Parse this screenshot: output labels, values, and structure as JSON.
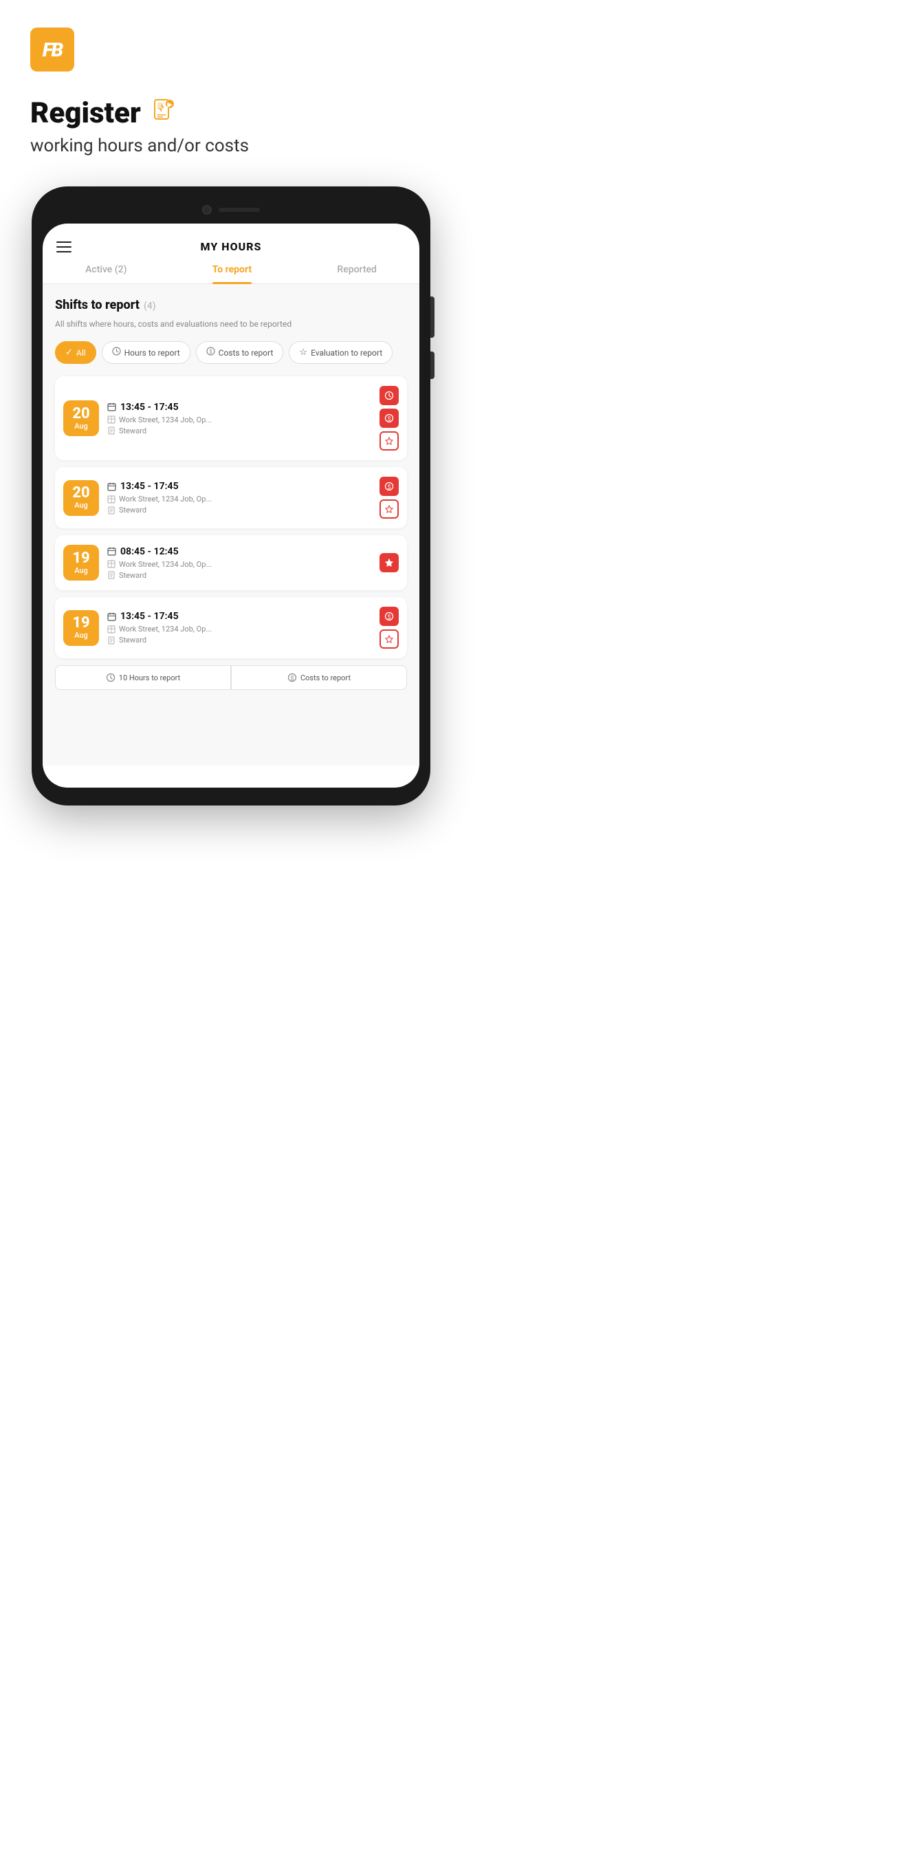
{
  "logo": {
    "text": "FB",
    "alt": "FB Logo"
  },
  "header": {
    "title": "Register",
    "subtitle": "working hours and/or costs",
    "title_icon": "⚡"
  },
  "app": {
    "screen_title": "MY HOURS",
    "tabs": [
      {
        "id": "active",
        "label": "Active (2)",
        "active": false
      },
      {
        "id": "to_report",
        "label": "To report",
        "active": true
      },
      {
        "id": "reported",
        "label": "Reported",
        "active": false
      }
    ],
    "section": {
      "title": "Shifts to report",
      "count": "(4)",
      "description": "All shifts where hours, costs and evaluations need to be reported"
    },
    "filters": [
      {
        "id": "all",
        "label": "All",
        "active": true,
        "icon": "✓"
      },
      {
        "id": "hours",
        "label": "Hours to report",
        "active": false,
        "icon": "🕐"
      },
      {
        "id": "costs",
        "label": "Costs to report",
        "active": false,
        "icon": "💰"
      },
      {
        "id": "evaluation",
        "label": "Evaluation to report",
        "active": false,
        "icon": "★"
      }
    ],
    "shifts": [
      {
        "id": 1,
        "day": "20",
        "month": "Aug",
        "time": "13:45 - 17:45",
        "location": "Work Street, 1234 Job, Op...",
        "role": "Steward",
        "actions": [
          "clock",
          "cost",
          "star"
        ],
        "has_clock": true,
        "has_cost": true,
        "has_star": true,
        "star_outline": false
      },
      {
        "id": 2,
        "day": "20",
        "month": "Aug",
        "time": "13:45 - 17:45",
        "location": "Work Street, 1234 Job, Op...",
        "role": "Steward",
        "actions": [
          "cost",
          "star"
        ],
        "has_clock": false,
        "has_cost": true,
        "has_star": true,
        "star_outline": true
      },
      {
        "id": 3,
        "day": "19",
        "month": "Aug",
        "time": "08:45 - 12:45",
        "location": "Work Street, 1234 Job, Op...",
        "role": "Steward",
        "actions": [
          "star"
        ],
        "has_clock": false,
        "has_cost": false,
        "has_star": true,
        "star_outline": false
      },
      {
        "id": 4,
        "day": "19",
        "month": "Aug",
        "time": "13:45 - 17:45",
        "location": "Work Street, 1234 Job, Op...",
        "role": "Steward",
        "actions": [
          "cost",
          "star"
        ],
        "has_clock": false,
        "has_cost": true,
        "has_star": true,
        "star_outline": true
      }
    ],
    "summary": {
      "hours_label": "10 Hours to report",
      "costs_label": "Costs to report"
    }
  },
  "colors": {
    "orange": "#F5A623",
    "red": "#e53935",
    "gray_text": "#888888",
    "dark_text": "#111111"
  }
}
